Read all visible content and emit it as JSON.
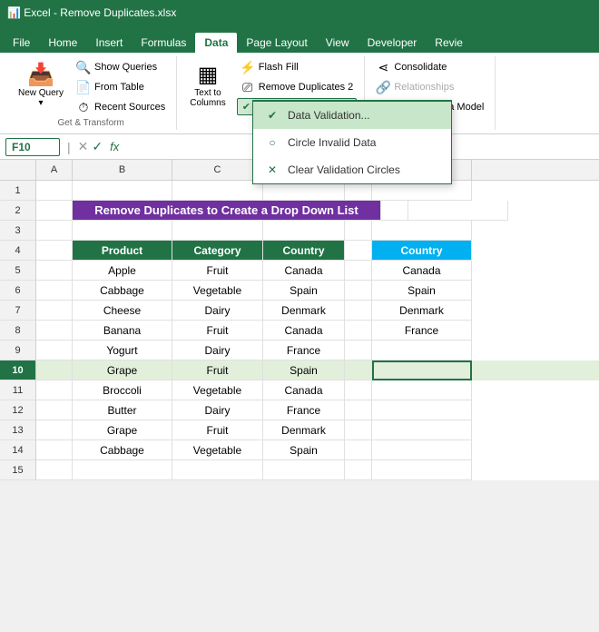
{
  "app": {
    "title": "Microsoft Excel",
    "active_cell": "F10"
  },
  "ribbon_tabs": [
    "File",
    "Home",
    "Insert",
    "Formulas",
    "Data",
    "Page Layout",
    "View",
    "Developer",
    "Revie"
  ],
  "active_tab": "Data",
  "groups": {
    "get_transform": {
      "label": "Get & Transform",
      "new_query": "New\nQuery",
      "show_queries": "Show Queries",
      "from_table": "From Table",
      "recent_sources": "Recent Sources"
    },
    "data_tools": {
      "flash_fill": "Flash Fill",
      "remove_duplicates": "Remove Duplicates 2",
      "text_to_columns": "Text to Columns",
      "data_validation": "Data Validation",
      "manage_data_model": "Manage Data Model"
    },
    "analyze": {
      "consolidate": "Consolidate",
      "relationships": "Relationships"
    }
  },
  "dropdown": {
    "items": [
      {
        "label": "Data Validation...",
        "active": true
      },
      {
        "label": "Circle Invalid Data",
        "active": false
      },
      {
        "label": "Clear Validation Circles",
        "active": false
      }
    ]
  },
  "formula_bar": {
    "cell_ref": "F10",
    "value": ""
  },
  "title_row": {
    "text": "Remove Duplicates to Create a Drop Down List",
    "bg": "#7030a0",
    "color": "white"
  },
  "headers": [
    "Product",
    "Category",
    "Country"
  ],
  "data_rows": [
    [
      "Apple",
      "Fruit",
      "Canada"
    ],
    [
      "Cabbage",
      "Vegetable",
      "Spain"
    ],
    [
      "Cheese",
      "Dairy",
      "Denmark"
    ],
    [
      "Banana",
      "Fruit",
      "Canada"
    ],
    [
      "Yogurt",
      "Dairy",
      "France"
    ],
    [
      "Grape",
      "Fruit",
      "Spain"
    ],
    [
      "Broccoli",
      "Vegetable",
      "Canada"
    ],
    [
      "Butter",
      "Dairy",
      "France"
    ],
    [
      "Grape",
      "Fruit",
      "Denmark"
    ],
    [
      "Cabbage",
      "Vegetable",
      "Spain"
    ]
  ],
  "country_header": "Country",
  "country_values": [
    "Canada",
    "Spain",
    "Denmark",
    "France"
  ],
  "col_widths": {
    "A": 40,
    "B": 110,
    "C": 100,
    "D": 90,
    "E": 30,
    "F": 110
  },
  "row_count": 15
}
